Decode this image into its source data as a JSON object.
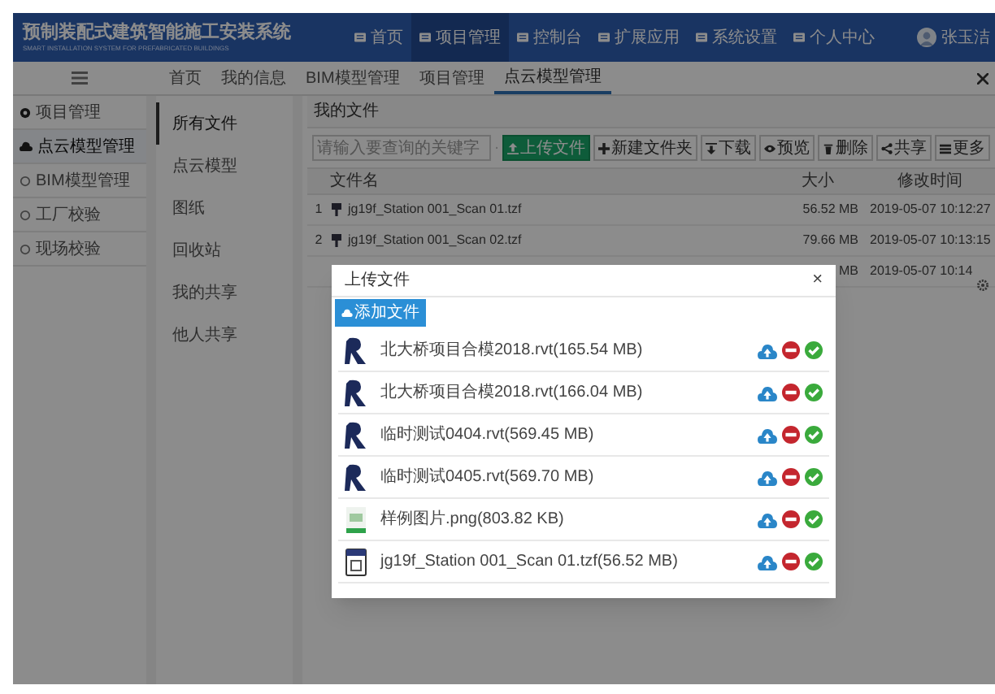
{
  "header": {
    "title": "预制装配式建筑智能施工安装系统",
    "subtitle": "SMART INSTALLATION SYSTEM FOR PREFABRICATED BUILDINGS",
    "nav": [
      {
        "label": "首页",
        "selected": false
      },
      {
        "label": "项目管理",
        "selected": true
      },
      {
        "label": "控制台",
        "selected": false
      },
      {
        "label": "扩展应用",
        "selected": false
      },
      {
        "label": "系统设置",
        "selected": false
      },
      {
        "label": "个人中心",
        "selected": false
      }
    ],
    "user": "张玉洁"
  },
  "breadcrumb": [
    {
      "label": "首页",
      "selected": false
    },
    {
      "label": "我的信息",
      "selected": false
    },
    {
      "label": "BIM模型管理",
      "selected": false
    },
    {
      "label": "项目管理",
      "selected": false
    },
    {
      "label": "点云模型管理",
      "selected": true
    }
  ],
  "sidebar": {
    "items": [
      {
        "label": "项目管理",
        "kind": "heading",
        "selected": false
      },
      {
        "label": "点云模型管理",
        "kind": "item",
        "selected": true
      },
      {
        "label": "BIM模型管理",
        "kind": "item",
        "selected": false
      },
      {
        "label": "工厂校验",
        "kind": "item",
        "selected": false
      },
      {
        "label": "现场校验",
        "kind": "item",
        "selected": false
      }
    ]
  },
  "submenu": [
    {
      "label": "所有文件",
      "selected": true
    },
    {
      "label": "点云模型",
      "selected": false
    },
    {
      "label": "图纸",
      "selected": false
    },
    {
      "label": "回收站",
      "selected": false
    },
    {
      "label": "我的共享",
      "selected": false
    },
    {
      "label": "他人共享",
      "selected": false
    }
  ],
  "main": {
    "title": "我的文件",
    "search": {
      "placeholder": "请输入要查询的关键字"
    },
    "toolbar": [
      {
        "label": "上传文件",
        "kind": "primary"
      },
      {
        "label": "新建文件夹",
        "kind": "plus"
      },
      {
        "label": "下载",
        "kind": "download"
      },
      {
        "label": "预览",
        "kind": "eye"
      },
      {
        "label": "删除",
        "kind": "trash"
      },
      {
        "label": "共享",
        "kind": "share"
      },
      {
        "label": "更多",
        "kind": "more"
      }
    ],
    "table": {
      "columns": [
        "文件名",
        "大小",
        "修改时间"
      ],
      "rows": [
        {
          "index": "1",
          "name": "jg19f_Station 001_Scan 01.tzf",
          "size": "56.52 MB",
          "modified": "2019-05-07 10:12:27"
        },
        {
          "index": "2",
          "name": "jg19f_Station 001_Scan 02.tzf",
          "size": "79.66 MB",
          "modified": "2019-05-07 10:13:15"
        },
        {
          "size": "MB",
          "modified": "2019-05-07 10:14"
        }
      ]
    }
  },
  "modal": {
    "title": "上传文件",
    "close": "×",
    "add_button": "添加文件",
    "files": [
      {
        "name": "北大桥项目合模2018.rvt(165.54 MB)",
        "kind": "rvt"
      },
      {
        "name": "北大桥项目合模2018.rvt(166.04 MB)",
        "kind": "rvt"
      },
      {
        "name": "临时测试0404.rvt(569.45 MB)",
        "kind": "rvt"
      },
      {
        "name": "临时测试0405.rvt(569.70 MB)",
        "kind": "rvt"
      },
      {
        "name": "样例图片.png(803.82 KB)",
        "kind": "png"
      },
      {
        "name": "jg19f_Station 001_Scan 01.tzf(56.52 MB)",
        "kind": "tzf"
      }
    ]
  }
}
